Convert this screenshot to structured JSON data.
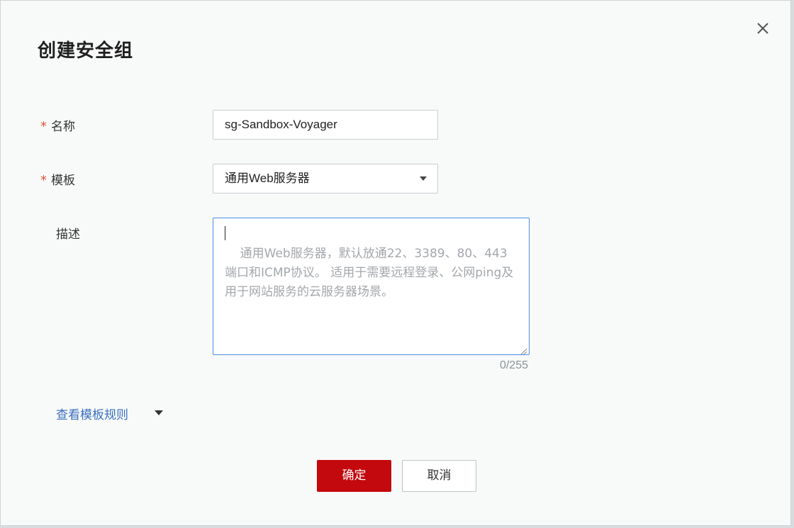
{
  "dialog": {
    "title": "创建安全组",
    "close_icon": "close-icon"
  },
  "form": {
    "name": {
      "label": "名称",
      "required_mark": "*",
      "value": "sg-Sandbox-Voyager"
    },
    "template": {
      "label": "模板",
      "required_mark": "*",
      "selected": "通用Web服务器",
      "dropdown_icon": "caret-down-icon"
    },
    "description": {
      "label": "描述",
      "placeholder": "通用Web服务器，默认放通22、3389、80、443端口和ICMP协议。 适用于需要远程登录、公网ping及用于网站服务的云服务器场景。",
      "value": "",
      "counter": "0/255"
    }
  },
  "links": {
    "view_rules": "查看模板规则",
    "view_rules_icon": "caret-down-icon"
  },
  "buttons": {
    "confirm": "确定",
    "cancel": "取消"
  },
  "colors": {
    "primary": "#c3090d",
    "required": "#e2513b",
    "link": "#3a6fbf",
    "focus_border": "#4a8de8"
  }
}
